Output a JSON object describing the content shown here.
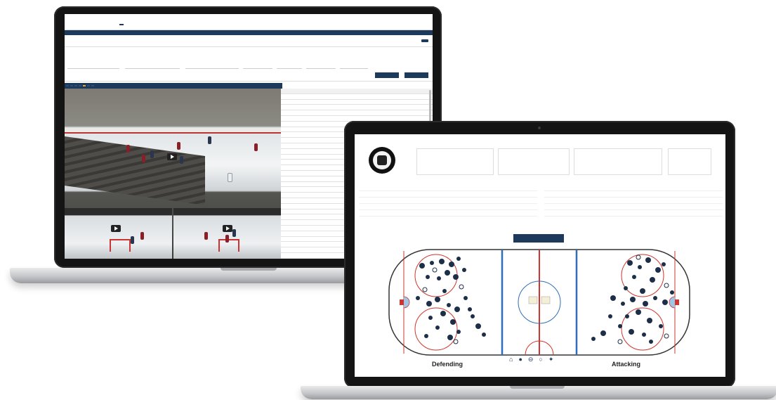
{
  "back_app": {
    "logo_lines": "",
    "top_tabs": [
      "",
      "",
      "",
      ""
    ],
    "nav_items": [
      "",
      "",
      "",
      "",
      "",
      "",
      "",
      ""
    ],
    "page_title": "",
    "title_button": "",
    "filter_chips": [
      "",
      "",
      "",
      "",
      "",
      "",
      ""
    ],
    "filter_labels": [
      "",
      "",
      "",
      "",
      "",
      "",
      ""
    ],
    "apply_buttons": [
      "",
      ""
    ],
    "video_toolbar": [
      "",
      "",
      "",
      "",
      "",
      "",
      ""
    ],
    "thumbnails": [
      "",
      ""
    ],
    "table_rows": 34
  },
  "front_app": {
    "menu": [
      "",
      "",
      "",
      "",
      "",
      "",
      "",
      ""
    ],
    "header_texts": [
      "",
      "",
      "",
      "",
      "",
      "",
      "",
      ""
    ],
    "left_stats": {
      "columns": [
        "",
        "",
        "",
        "",
        ""
      ],
      "rows": [
        [
          "",
          "",
          "",
          "",
          ""
        ],
        [
          "",
          "",
          "",
          "",
          ""
        ],
        [
          "",
          "",
          "",
          "",
          ""
        ],
        [
          "",
          "",
          "",
          "",
          ""
        ]
      ]
    },
    "right_stats": {
      "columns": [
        "",
        "",
        "",
        "",
        ""
      ],
      "rows": [
        [
          "",
          "",
          "",
          "",
          ""
        ],
        [
          "",
          "",
          "",
          "",
          ""
        ],
        [
          "",
          "",
          "",
          "",
          ""
        ],
        [
          "",
          "",
          "",
          "",
          ""
        ]
      ]
    },
    "zone_tabs": [
      "",
      ""
    ],
    "total_button": "",
    "defending_label": "Defending",
    "attacking_label": "Attacking",
    "legend": [
      {
        "icon": "goal-icon",
        "glyph": "⌂",
        "label": ""
      },
      {
        "icon": "shot-icon",
        "glyph": "●",
        "label": ""
      },
      {
        "icon": "blocked-icon",
        "glyph": "⊖",
        "label": ""
      },
      {
        "icon": "missed-icon",
        "glyph": "○",
        "label": ""
      },
      {
        "icon": "post-icon",
        "glyph": "✦",
        "label": ""
      }
    ],
    "accent": "#1d3a5c",
    "rink_red": "#d0342c",
    "rink_blue": "#2f6fb5",
    "shot_color": "#1d2f48"
  }
}
